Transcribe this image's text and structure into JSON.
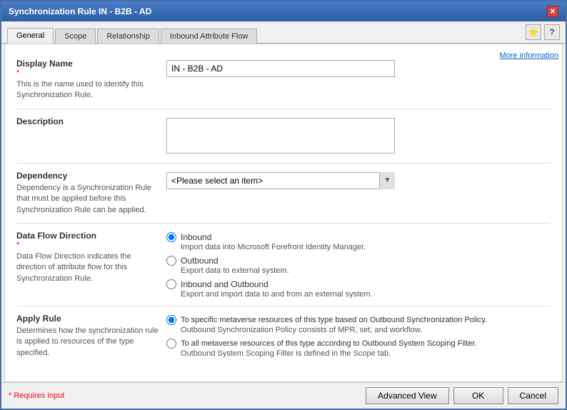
{
  "window": {
    "title": "Synchronization Rule IN - B2B - AD",
    "close_label": "✕"
  },
  "tabs": [
    {
      "id": "general",
      "label": "General",
      "active": true
    },
    {
      "id": "scope",
      "label": "Scope",
      "active": false
    },
    {
      "id": "relationship",
      "label": "Relationship",
      "active": false
    },
    {
      "id": "inbound-attribute-flow",
      "label": "Inbound Attribute Flow",
      "active": false
    }
  ],
  "icons": {
    "star_icon": "⭐",
    "help_icon": "?",
    "more_info": "More information"
  },
  "form": {
    "display_name": {
      "label": "Display Name",
      "desc": "This is the name used to identify this Synchronization Rule.",
      "value": "IN - B2B - AD",
      "placeholder": ""
    },
    "description": {
      "label": "Description",
      "value": "",
      "placeholder": ""
    },
    "dependency": {
      "label": "Dependency",
      "desc": "Dependency is a Synchronization Rule that must be applied before this Synchronization Rule can be applied.",
      "placeholder": "<Please select an item>",
      "options": [
        "<Please select an item>"
      ]
    },
    "data_flow_direction": {
      "label": "Data Flow Direction",
      "desc": "Data Flow Direction indicates the direction of attribute flow for this Synchronization Rule.",
      "options": [
        {
          "id": "inbound",
          "label": "Inbound",
          "desc": "Import data into Microsoft Forefront Identity Manager.",
          "checked": true
        },
        {
          "id": "outbound",
          "label": "Outbound",
          "desc": "Export data to external system.",
          "checked": false
        },
        {
          "id": "inbound-outbound",
          "label": "Inbound and Outbound",
          "desc": "Export and import data to and from an external system.",
          "checked": false
        }
      ]
    },
    "apply_rule": {
      "label": "Apply Rule",
      "desc": "Determines how the synchronization rule is applied to resources of the type specified.",
      "options": [
        {
          "id": "specific",
          "label": "To specific metaverse resources of this type based on Outbound Synchronization Policy.",
          "desc": "Outbound Synchronization Policy consists of MPR, set, and workflow.",
          "checked": true
        },
        {
          "id": "all",
          "label": "To all metaverse resources of this type according to Outbound System Scoping Filter.",
          "desc": "Outbound System Scoping Filter is defined in the Scope tab.",
          "checked": false
        }
      ]
    }
  },
  "footer": {
    "requires_input": "* Requires input",
    "advanced_view": "Advanced View",
    "ok": "OK",
    "cancel": "Cancel"
  }
}
